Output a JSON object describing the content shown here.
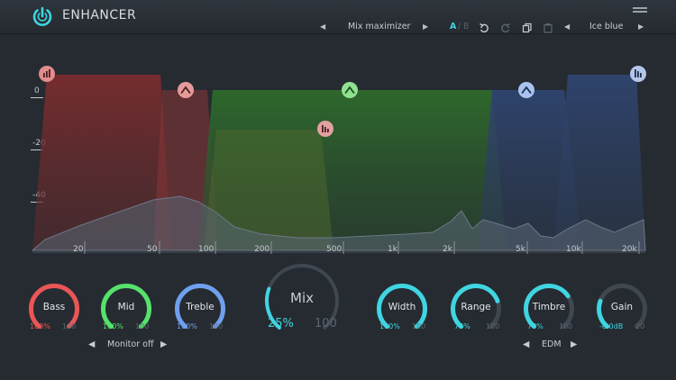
{
  "header": {
    "title": "ENHANCER",
    "preset_name": "Mix maximizer",
    "prev_arrow": "◀",
    "next_arrow": "▶",
    "ab_a": "A",
    "ab_sep": "/",
    "ab_b": "B",
    "theme_name": "Ice blue",
    "accent_color": "#3fd5e1"
  },
  "graph": {
    "db_labels": [
      "0",
      "-20",
      "-40"
    ],
    "freq_labels": [
      "20",
      "50",
      "100",
      "200",
      "500",
      "1k",
      "2k",
      "5k",
      "10k",
      "20k"
    ],
    "band_handles": [
      {
        "name": "bass-low-shelf",
        "icon": "shelf-icon",
        "color": "#e28c8c"
      },
      {
        "name": "bass-bell",
        "icon": "bell-icon",
        "color": "#e79a9a"
      },
      {
        "name": "mid-bell",
        "icon": "bell-icon",
        "color": "#8fe28f"
      },
      {
        "name": "mid-shelf",
        "icon": "shelf-icon",
        "color": "#e3a0a0"
      },
      {
        "name": "treble-bell",
        "icon": "bell-icon",
        "color": "#a8c3ef"
      },
      {
        "name": "treble-shelf",
        "icon": "shelf-icon",
        "color": "#b4c6ea"
      }
    ]
  },
  "knobs": {
    "bass": {
      "label": "Bass",
      "value": "100%",
      "max": "100",
      "fraction": 1.0,
      "color": "#ea5656"
    },
    "mid": {
      "label": "Mid",
      "value": "100%",
      "max": "100",
      "fraction": 1.0,
      "color": "#55e36b"
    },
    "treble": {
      "label": "Treble",
      "value": "100%",
      "max": "100",
      "fraction": 1.0,
      "color": "#6fa0ef"
    },
    "mix": {
      "label": "Mix",
      "value": "25%",
      "max": "100",
      "fraction": 0.25,
      "color": "#3fd5e1"
    },
    "width": {
      "label": "Width",
      "value": "100%",
      "max": "100",
      "fraction": 1.0,
      "color": "#3fd5e1"
    },
    "range": {
      "label": "Range",
      "value": "75%",
      "max": "100",
      "fraction": 0.75,
      "color": "#3fd5e1"
    },
    "timbre": {
      "label": "Timbre",
      "value": "70%",
      "max": "100",
      "fraction": 0.7,
      "color": "#3fd5e1"
    },
    "gain": {
      "label": "Gain",
      "value": "-6.0dB",
      "max": "20",
      "fraction": 0.25,
      "color": "#3fd5e1"
    }
  },
  "monitor": {
    "value": "Monitor off"
  },
  "style_select": {
    "value": "EDM"
  }
}
